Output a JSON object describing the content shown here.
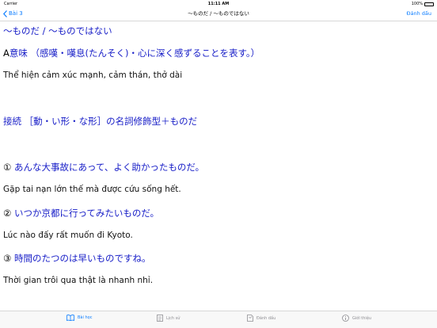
{
  "status_bar": {
    "carrier": "Carrier",
    "time": "11:11 AM",
    "battery": "100%"
  },
  "nav": {
    "back_label": "Bài 3",
    "title": "〜ものだ / 〜ものではない",
    "bookmark_label": "Đánh dấu"
  },
  "content": {
    "heading": "〜ものだ / 〜ものではない",
    "meaning_label": "A",
    "meaning": "意味 （感嘆・嘆息(たんそく)・心に深く感ずることを表す。）",
    "meaning_vn": "Thể hiện cảm xúc mạnh, cảm thán, thở dài",
    "connection": "接続 ［動・い形・な形］の名詞修飾型＋ものだ",
    "examples": [
      {
        "num": "①",
        "jp": "あんな大事故にあって、よく助かったものだ。",
        "vn": "Gặp tai nạn lớn thế mà được cứu sống hết."
      },
      {
        "num": "②",
        "jp": "いつか京都に行ってみたいものだ。",
        "vn": "Lúc nào đấy rất muốn đi Kyoto."
      },
      {
        "num": "③",
        "jp": "時間のたつのは早いものですね。",
        "vn": "Thời gian trôi qua thật là nhanh nhỉ."
      }
    ]
  },
  "tabs": [
    {
      "label": "Bài học",
      "icon": "book-icon",
      "active": true
    },
    {
      "label": "Lịch sử",
      "icon": "history-icon",
      "active": false
    },
    {
      "label": "Đánh dấu",
      "icon": "bookmark-icon",
      "active": false
    },
    {
      "label": "Giới thiệu",
      "icon": "info-icon",
      "active": false
    }
  ],
  "colors": {
    "accent": "#0a7cff",
    "japanese_text": "#1a20c8",
    "tab_inactive": "#8e8e93"
  }
}
